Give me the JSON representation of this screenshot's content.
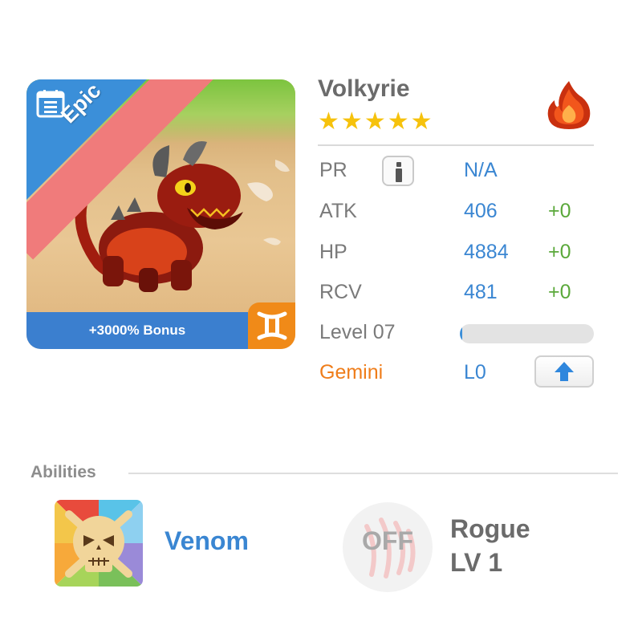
{
  "monster": {
    "name": "Volkyrie",
    "stars": 5,
    "rarity": "Epic",
    "bonus": "+3000% Bonus",
    "element_icon": "fire-icon",
    "zodiac_icon": "gemini-symbol-icon"
  },
  "stats": {
    "pr": {
      "label": "PR",
      "value": "N/A"
    },
    "atk": {
      "label": "ATK",
      "value": "406",
      "bonus": "+0"
    },
    "hp": {
      "label": "HP",
      "value": "4884",
      "bonus": "+0"
    },
    "rcv": {
      "label": "RCV",
      "value": "481",
      "bonus": "+0"
    },
    "level": {
      "label": "Level 07",
      "progress": 0.02
    },
    "zodiac": {
      "label": "Gemini",
      "value": "L0"
    }
  },
  "abilities": {
    "title": "Abilities",
    "skill": {
      "name": "Venom",
      "icon": "skull-icon"
    },
    "passive": {
      "state": "OFF",
      "name": "Rogue",
      "level": "LV 1",
      "icon": "claw-icon"
    }
  },
  "colors": {
    "accent_blue": "#3a86d2",
    "bonus_green": "#5aa83a",
    "gemini_orange": "#ef7d1a",
    "star_gold": "#f6c20c",
    "epic_ribbon": "#f07b7b"
  }
}
